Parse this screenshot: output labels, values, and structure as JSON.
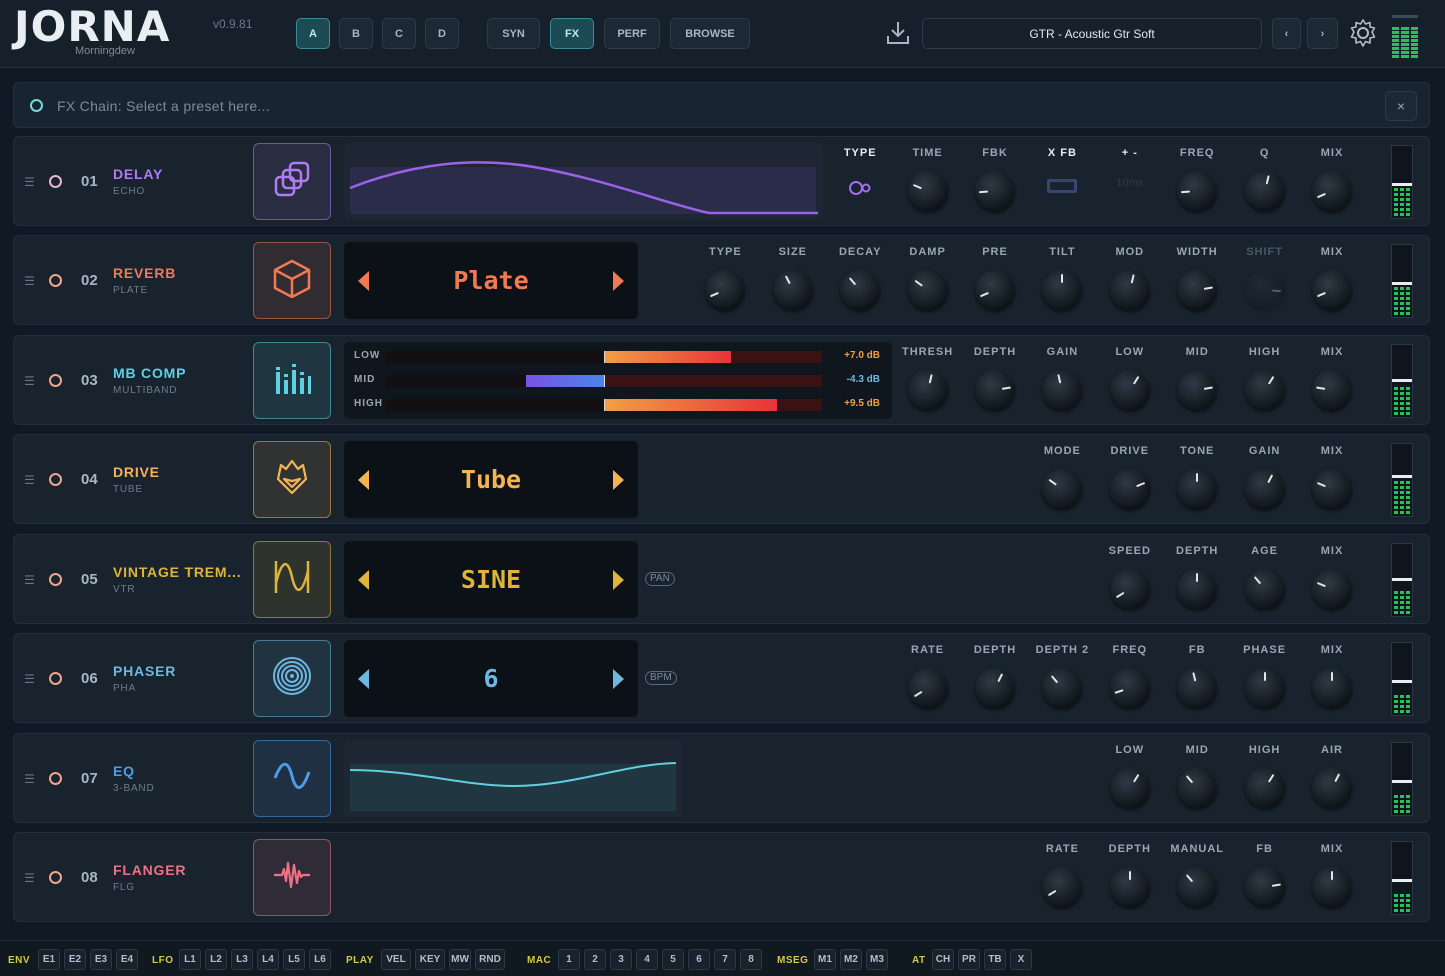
{
  "header": {
    "logo": "JORNA",
    "version": "v0.9.81",
    "subtitle": "Morningdew",
    "slot_buttons": [
      "A",
      "B",
      "C",
      "D"
    ],
    "active_slot": "A",
    "view_buttons": [
      "SYN",
      "FX",
      "PERF",
      "BROWSE"
    ],
    "active_view": "FX",
    "preset_name": "GTR - Acoustic Gtr Soft",
    "icons": [
      "download-icon",
      "chevron-left-icon",
      "chevron-right-icon",
      "gear-icon"
    ]
  },
  "fx_search": {
    "placeholder": "FX Chain: Select a preset here...",
    "close_label": "×"
  },
  "slots": [
    {
      "num": "01",
      "name": "DELAY",
      "sub": "ECHO",
      "color": "#b07cf0",
      "icon": "stacked-squares-icon",
      "display_type": "curve",
      "params": [
        {
          "label": "TYPE",
          "style": "bright",
          "value_icon": "ping-pong-icon"
        },
        {
          "label": "TIME",
          "value": 0.25
        },
        {
          "label": "FBK",
          "value": 0.15
        },
        {
          "label": "X FB",
          "style": "bright",
          "value_icon": "toggle-switch-icon"
        },
        {
          "label": "+ -",
          "style": "bright",
          "value_text": "10ms"
        },
        {
          "label": "FREQ",
          "value": 0.15
        },
        {
          "label": "Q",
          "value": 0.55
        },
        {
          "label": "MIX",
          "value": 0.08
        }
      ],
      "meter_level": 0.42,
      "meter_peak": 0.46
    },
    {
      "num": "02",
      "name": "REVERB",
      "sub": "PLATE",
      "color": "#f27a53",
      "icon": "cube-icon",
      "display_type": "selector",
      "display_text": "Plate",
      "params": [
        {
          "label": "TYPE",
          "value": 0.08
        },
        {
          "label": "SIZE",
          "value": 0.4
        },
        {
          "label": "DECAY",
          "value": 0.35
        },
        {
          "label": "DAMP",
          "value": 0.3
        },
        {
          "label": "PRE",
          "value": 0.08
        },
        {
          "label": "TILT",
          "value": 0.5
        },
        {
          "label": "MOD",
          "value": 0.55
        },
        {
          "label": "WIDTH",
          "value": 0.8
        },
        {
          "label": "SHIFT",
          "value": 0.85,
          "dim": true
        },
        {
          "label": "MIX",
          "value": 0.08
        }
      ],
      "meter_level": 0.42,
      "meter_peak": 0.46
    },
    {
      "num": "03",
      "name": "MB COMP",
      "sub": "MULTIBAND",
      "color": "#5fd0e2",
      "icon": "eq-bars-icon",
      "display_type": "bands",
      "bands": [
        {
          "label": "LOW",
          "value": "+7.0 dB",
          "db": 7.0
        },
        {
          "label": "MID",
          "value": "-4.3 dB",
          "db": -4.3
        },
        {
          "label": "HIGH",
          "value": "+9.5 dB",
          "db": 9.5
        }
      ],
      "params": [
        {
          "label": "THRESH",
          "value": 0.55
        },
        {
          "label": "DEPTH",
          "value": 0.8
        },
        {
          "label": "GAIN",
          "value": 0.45
        },
        {
          "label": "LOW",
          "value": 0.62
        },
        {
          "label": "MID",
          "value": 0.8
        },
        {
          "label": "HIGH",
          "value": 0.62
        },
        {
          "label": "MIX",
          "value": 0.2
        }
      ],
      "meter_level": 0.42,
      "meter_peak": 0.5
    },
    {
      "num": "04",
      "name": "DRIVE",
      "sub": "TUBE",
      "color": "#f5b453",
      "icon": "fox-icon",
      "display_type": "selector",
      "display_text": "Tube",
      "params": [
        {
          "label": "MODE",
          "value": 0.3
        },
        {
          "label": "DRIVE",
          "value": 0.75
        },
        {
          "label": "TONE",
          "value": 0.5
        },
        {
          "label": "GAIN",
          "value": 0.6
        },
        {
          "label": "MIX",
          "value": 0.25
        }
      ],
      "meter_level": 0.5,
      "meter_peak": 0.54
    },
    {
      "num": "05",
      "name": "VINTAGE TREM...",
      "sub": "VTR",
      "color": "#e0b43a",
      "icon": "sine-wave-icon",
      "display_type": "selector",
      "display_text": "SINE",
      "pill": "PAN",
      "params": [
        {
          "label": "SPEED",
          "value": 0.05
        },
        {
          "label": "DEPTH",
          "value": 0.5
        },
        {
          "label": "AGE",
          "value": 0.35
        },
        {
          "label": "MIX",
          "value": 0.25
        }
      ],
      "meter_level": 0.38,
      "meter_peak": 0.5
    },
    {
      "num": "06",
      "name": "PHASER",
      "sub": "PHA",
      "color": "#6fb7e0",
      "icon": "spiral-icon",
      "display_type": "selector",
      "display_text": "6",
      "pill": "BPM",
      "params": [
        {
          "label": "RATE",
          "value": 0.05
        },
        {
          "label": "DEPTH",
          "value": 0.6
        },
        {
          "label": "DEPTH 2",
          "value": 0.35
        },
        {
          "label": "FREQ",
          "value": 0.1
        },
        {
          "label": "FB",
          "value": 0.45
        },
        {
          "label": "PHASE",
          "value": 0.5
        },
        {
          "label": "MIX",
          "value": 0.5
        }
      ],
      "meter_level": 0.28,
      "meter_peak": 0.46
    },
    {
      "num": "07",
      "name": "EQ",
      "sub": "3-BAND",
      "color": "#4f9ce8",
      "icon": "wave-icon",
      "display_type": "eq",
      "params": [
        {
          "label": "LOW",
          "value": 0.62
        },
        {
          "label": "MID",
          "value": 0.35
        },
        {
          "label": "HIGH",
          "value": 0.62
        },
        {
          "label": "AIR",
          "value": 0.6
        }
      ],
      "meter_level": 0.32,
      "meter_peak": 0.46
    },
    {
      "num": "08",
      "name": "FLANGER",
      "sub": "FLG",
      "color": "#f07085",
      "icon": "heartbeat-icon",
      "display_type": "none",
      "params": [
        {
          "label": "RATE",
          "value": 0.05
        },
        {
          "label": "DEPTH",
          "value": 0.5
        },
        {
          "label": "MANUAL",
          "value": 0.35
        },
        {
          "label": "FB",
          "value": 0.8
        },
        {
          "label": "MIX",
          "value": 0.5
        }
      ],
      "meter_level": 0.28,
      "meter_peak": 0.46
    }
  ],
  "bottom_bar": [
    {
      "group": "ENV",
      "chips": [
        "E1",
        "E2",
        "E3",
        "E4"
      ]
    },
    {
      "group": "LFO",
      "chips": [
        "L1",
        "L2",
        "L3",
        "L4",
        "L5",
        "L6"
      ]
    },
    {
      "group": "PLAY",
      "chips": [
        "VEL",
        "KEY",
        "MW",
        "RND"
      ]
    },
    {
      "group": "MAC",
      "chips": [
        "1",
        "2",
        "3",
        "4",
        "5",
        "6",
        "7",
        "8"
      ]
    },
    {
      "group": "MSEG",
      "chips": [
        "M1",
        "M2",
        "M3"
      ]
    },
    {
      "group": "AT",
      "chips": [
        "CH",
        "PR",
        "TB",
        "X"
      ]
    }
  ]
}
